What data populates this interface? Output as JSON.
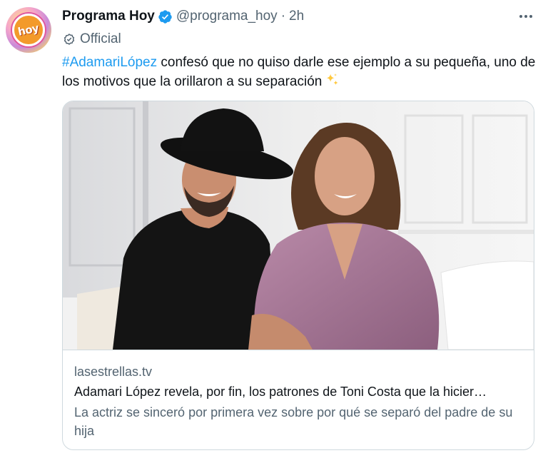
{
  "author": {
    "display_name": "Programa Hoy",
    "handle": "@programa_hoy",
    "separator": "·",
    "time": "2h",
    "official_label": "Official",
    "avatar_logo_text": "hoy",
    "verified_badge_color": "#1d9bf0"
  },
  "tweet": {
    "hashtag": "#AdamariLópez",
    "text": " confesó que no quiso darle ese ejemplo a su pequeña, uno de los motivos que la orillaron a su separación",
    "emoji_icon": "sparkles-icon",
    "hashtag_color": "#1d9bf0"
  },
  "card": {
    "domain": "lasestrellas.tv",
    "title": "Adamari López revela, por fin, los patrones de Toni Costa que la hicier…",
    "description": "La actriz se sinceró por primera vez sobre por qué se separó del padre de su hija"
  },
  "icons": {
    "more": "more-options-icon",
    "verified": "verified-badge-icon",
    "official": "official-check-icon"
  }
}
